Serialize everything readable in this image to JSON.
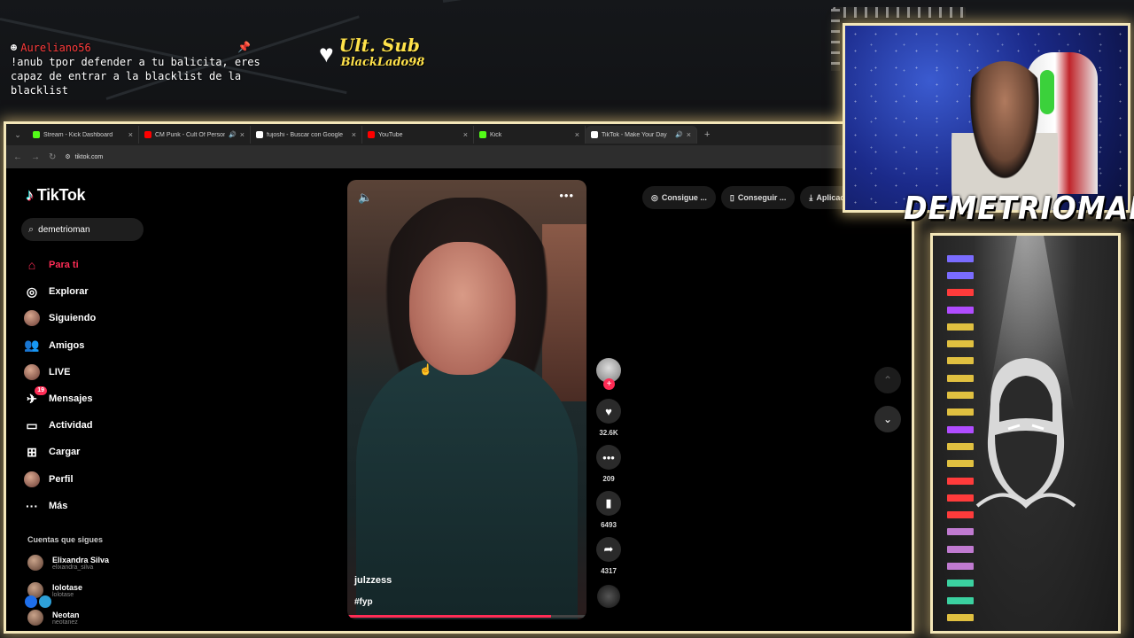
{
  "overlay": {
    "chat_user": "Aureliano56",
    "chat_message": "!anub tpor defender a tu balicita, eres capaz de entrar a la blacklist de la blacklist",
    "ult_sub_title": "Ult. Sub",
    "ult_sub_name": "BlackLado98",
    "streamer_name": "DEMETRIOMAN",
    "brand_color": "#f3e6b8"
  },
  "browser": {
    "tabs": [
      {
        "label": "Stream - Kick Dashboard",
        "favicon_color": "#53fc18",
        "audio": false
      },
      {
        "label": "CM Punk - Cult Of Persona",
        "favicon_color": "#ff0000",
        "audio": true
      },
      {
        "label": "fujoshi - Buscar con Google",
        "favicon_color": "#ffffff",
        "audio": false
      },
      {
        "label": "YouTube",
        "favicon_color": "#ff0000",
        "audio": false
      },
      {
        "label": "Kick",
        "favicon_color": "#53fc18",
        "audio": false
      },
      {
        "label": "TikTok - Make Your Day",
        "favicon_color": "#ffffff",
        "audio": true
      }
    ],
    "active_tab_index": 5,
    "url": "tiktok.com"
  },
  "tiktok": {
    "logo": "TikTok",
    "search_value": "demetrioman",
    "nav": [
      {
        "label": "Para ti",
        "icon": "home-icon",
        "active": true
      },
      {
        "label": "Explorar",
        "icon": "compass-icon",
        "active": false
      },
      {
        "label": "Siguiendo",
        "icon": "following-avatar-icon",
        "active": false
      },
      {
        "label": "Amigos",
        "icon": "friends-icon",
        "active": false
      },
      {
        "label": "LIVE",
        "icon": "live-avatar-icon",
        "active": false
      },
      {
        "label": "Mensajes",
        "icon": "messages-icon",
        "active": false,
        "badge": "19"
      },
      {
        "label": "Actividad",
        "icon": "activity-icon",
        "active": false
      },
      {
        "label": "Cargar",
        "icon": "upload-icon",
        "active": false
      },
      {
        "label": "Perfil",
        "icon": "profile-avatar-icon",
        "active": false
      },
      {
        "label": "Más",
        "icon": "more-icon",
        "active": false
      }
    ],
    "following_heading": "Cuentas que sigues",
    "following": [
      {
        "name": "Elixandra Silva",
        "handle": "elixandra_silva"
      },
      {
        "name": "lolotase",
        "handle": "lolotase"
      },
      {
        "name": "Neotan",
        "handle": "neotanez"
      }
    ],
    "top_actions": [
      {
        "label": "Consigue ...",
        "icon": "coin-icon"
      },
      {
        "label": "Conseguir ...",
        "icon": "phone-icon"
      },
      {
        "label": "Aplicación",
        "icon": "download-icon"
      }
    ],
    "video": {
      "author": "julzzess",
      "hashtag": "#fyp",
      "progress": 0.85,
      "likes": "32.6K",
      "comments": "209",
      "saves": "6493",
      "shares": "4317"
    },
    "accent": "#fe2c55"
  }
}
